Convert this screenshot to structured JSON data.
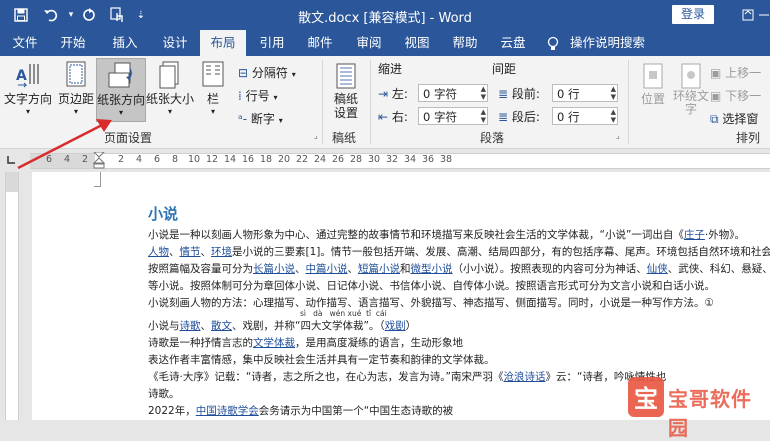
{
  "window": {
    "title": "散文.docx [兼容模式] - Word",
    "login": "登录"
  },
  "tabs": [
    "文件",
    "开始",
    "插入",
    "设计",
    "布局",
    "引用",
    "邮件",
    "审阅",
    "视图",
    "帮助",
    "云盘",
    "操作说明搜索"
  ],
  "active_tab": "布局",
  "ribbon": {
    "page_setup": {
      "text_direction": "文字方向",
      "margins": "页边距",
      "orientation": "纸张方向",
      "size": "纸张大小",
      "columns": "栏",
      "breaks": "分隔符",
      "line_numbers": "行号",
      "hyphenation": "断字",
      "group_label": "页面设置"
    },
    "draft": {
      "button": "稿纸\n设置",
      "group_label": "稿纸"
    },
    "paragraph": {
      "indent_header": "缩进",
      "spacing_header": "间距",
      "left_label": "左:",
      "left_value": "0 字符",
      "right_label": "右:",
      "right_value": "0 字符",
      "before_label": "段前:",
      "before_value": "0 行",
      "after_label": "段后:",
      "after_value": "0 行",
      "group_label": "段落"
    },
    "arrange": {
      "position": "位置",
      "wrap_text": "环绕文\n字",
      "bring_forward": "上移一",
      "send_backward": "下移一",
      "selection_pane": "选择窗",
      "group_label": "排列"
    }
  },
  "ruler": {
    "numbers": [
      "6",
      "4",
      "2",
      "2",
      "4",
      "6",
      "8",
      "10",
      "12",
      "14",
      "16",
      "18",
      "20",
      "22",
      "24",
      "26",
      "28",
      "30",
      "32",
      "34",
      "36",
      "38"
    ]
  },
  "document": {
    "heading": "小说",
    "line1": "小说是一种以刻画人物形象为中心、通过完整的故事情节和环境描写来反映社会生活的文学体裁，“小说”一词出自《",
    "line1_link": "庄子",
    "line1_end": "·外物》。",
    "line2_l1": "人物",
    "line2_s1": "、",
    "line2_l2": "情节",
    "line2_s2": "、",
    "line2_l3": "环境",
    "line2_rest": "是小说的三要素[1]。情节一般包括开端、发展、高潮、结局四部分，有的包括序幕、尾声。环境包括自然环境和社会环境",
    "line3_a": "按照篇幅及容量可分为",
    "line3_l1": "长篇小说",
    "line3_s1": "、",
    "line3_l2": "中篇小说",
    "line3_s2": "、",
    "line3_l3": "短篇小说",
    "line3_s3": "和",
    "line3_l4": "微型小说",
    "line3_b": "（小小说）。按照表现的内容可分为神话、",
    "line3_l5": "仙侠",
    "line3_c": "、武侠、科幻、悬疑、古传",
    "line4": "等小说。按照体制可分为章回体小说、日记体小说、书信体小说、自传体小说。按照语言形式可分为文言小说和白话小说。",
    "line5": "小说刻画人物的方法：心理描写、动作描写、语言描写、外貌描写、神态描写、侧面描写。同时，小说是一种写作方法。①",
    "line6_a": "小说与",
    "line6_l1": "诗歌",
    "line6_s1": "、",
    "line6_l2": "散文",
    "line6_b": "、戏剧，并称“四大文学体裁”。（",
    "line6_l3": "戏剧",
    "line6_c": "）",
    "line6_ruby": "sì   dà   wén xué  tǐ  cái",
    "line7_a": "诗歌是一种抒情言志的",
    "line7_l1": "文学体裁",
    "line7_b": "，是用高度凝练的语言，生动形象地",
    "line8": "表达作者丰富情感，集中反映社会生活并具有一定节奏和韵律的文学体裁。",
    "line9_a": "《毛诗·大序》记载：“诗者，志之所之也，在心为志，发言为诗。”南宋严羽《",
    "line9_l1": "沧浪诗话",
    "line9_b": "》云：“诗者，吟咏情性也",
    "line10": "诗歌。",
    "line11_a": "2022年，",
    "line11_l1": "中国诗歌学会",
    "line11_b": "会务请示为中国第一个“中国生态诗歌的被"
  },
  "watermark": {
    "text": "宝哥软件园"
  },
  "colors": {
    "brand": "#2b579a",
    "link": "#1f4e9a",
    "heading": "#2e74b5",
    "arrow": "#d92b2b"
  }
}
